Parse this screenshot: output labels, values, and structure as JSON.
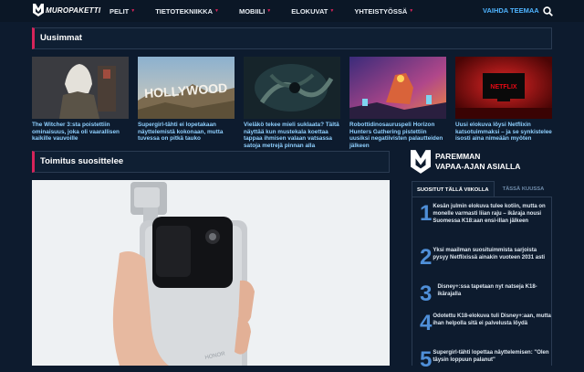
{
  "brand": {
    "logo_text": "MUROPAKETTI"
  },
  "nav": {
    "items": [
      {
        "label": "PELIT"
      },
      {
        "label": "TIETOTEKNIIKKA"
      },
      {
        "label": "MOBIILI"
      },
      {
        "label": "ELOKUVAT"
      },
      {
        "label": "YHTEISTYÖSSÄ"
      }
    ],
    "theme_label": "VAIHDA TEEMAA"
  },
  "latest": {
    "heading": "Uusimmat",
    "items": [
      {
        "caption": "The Witcher 3:sta poistettiin ominaisuus, joka oli vaarallisen kaikille vauvoille"
      },
      {
        "caption": "Supergirl-tähti ei lopetakaan näyttelemistä kokonaan, mutta tuvessa on pitkä tauko"
      },
      {
        "caption": "Vieläkö tekee mieli suklaata? Tältä näyttää kun mustekala koettaa tappaa ihmisen valaan vatsassa satoja metrejä pinnan alla"
      },
      {
        "caption": "Robottidinosauruspeli Horizon Hunters Gathering pistettiin uusiksi negatiivisten palautteiden jälkeen"
      },
      {
        "caption": "Uusi elokuva löysi Netflixin katsotuimmaksi – ja se synkistelee isosti aina nimeään myöten"
      }
    ]
  },
  "featured": {
    "heading": "Toimitus suosittelee"
  },
  "sidebar": {
    "title_line1": "PAREMMAN",
    "title_line2": "VAPAA-AJAN ASIALLA",
    "tabs": [
      {
        "label": "SUOSITUT TÄLLÄ VIIKOLLA"
      },
      {
        "label": "TÄSSÄ KUUSSA"
      }
    ],
    "popular": [
      {
        "rank": "1",
        "text": "Kesän julmin elokuva tulee kotiin, mutta on monelle varmasti liian raju – ikäraja nousi Suomessa K18:aan ensi-illan jälkeen"
      },
      {
        "rank": "2",
        "text": "Yksi maailman suosituimmista sarjoista pysyy Netflixissä ainakin vuoteen 2031 asti"
      },
      {
        "rank": "3",
        "text": "Disney+:ssa tapetaan nyt natseja K18-ikärajalla"
      },
      {
        "rank": "4",
        "text": "Odotettu K18-elokuva tuli Disney+:aan, mutta ihan helpolla sitä ei palvelusta löydä"
      },
      {
        "rank": "5",
        "text": "Supergirl-tähti lopettaa näyttelemisen: \"Olen täysin loppuun palanut\""
      }
    ]
  },
  "colors": {
    "accent": "#d6245a",
    "link": "#4fb4ff",
    "background": "#0d1b2e"
  }
}
